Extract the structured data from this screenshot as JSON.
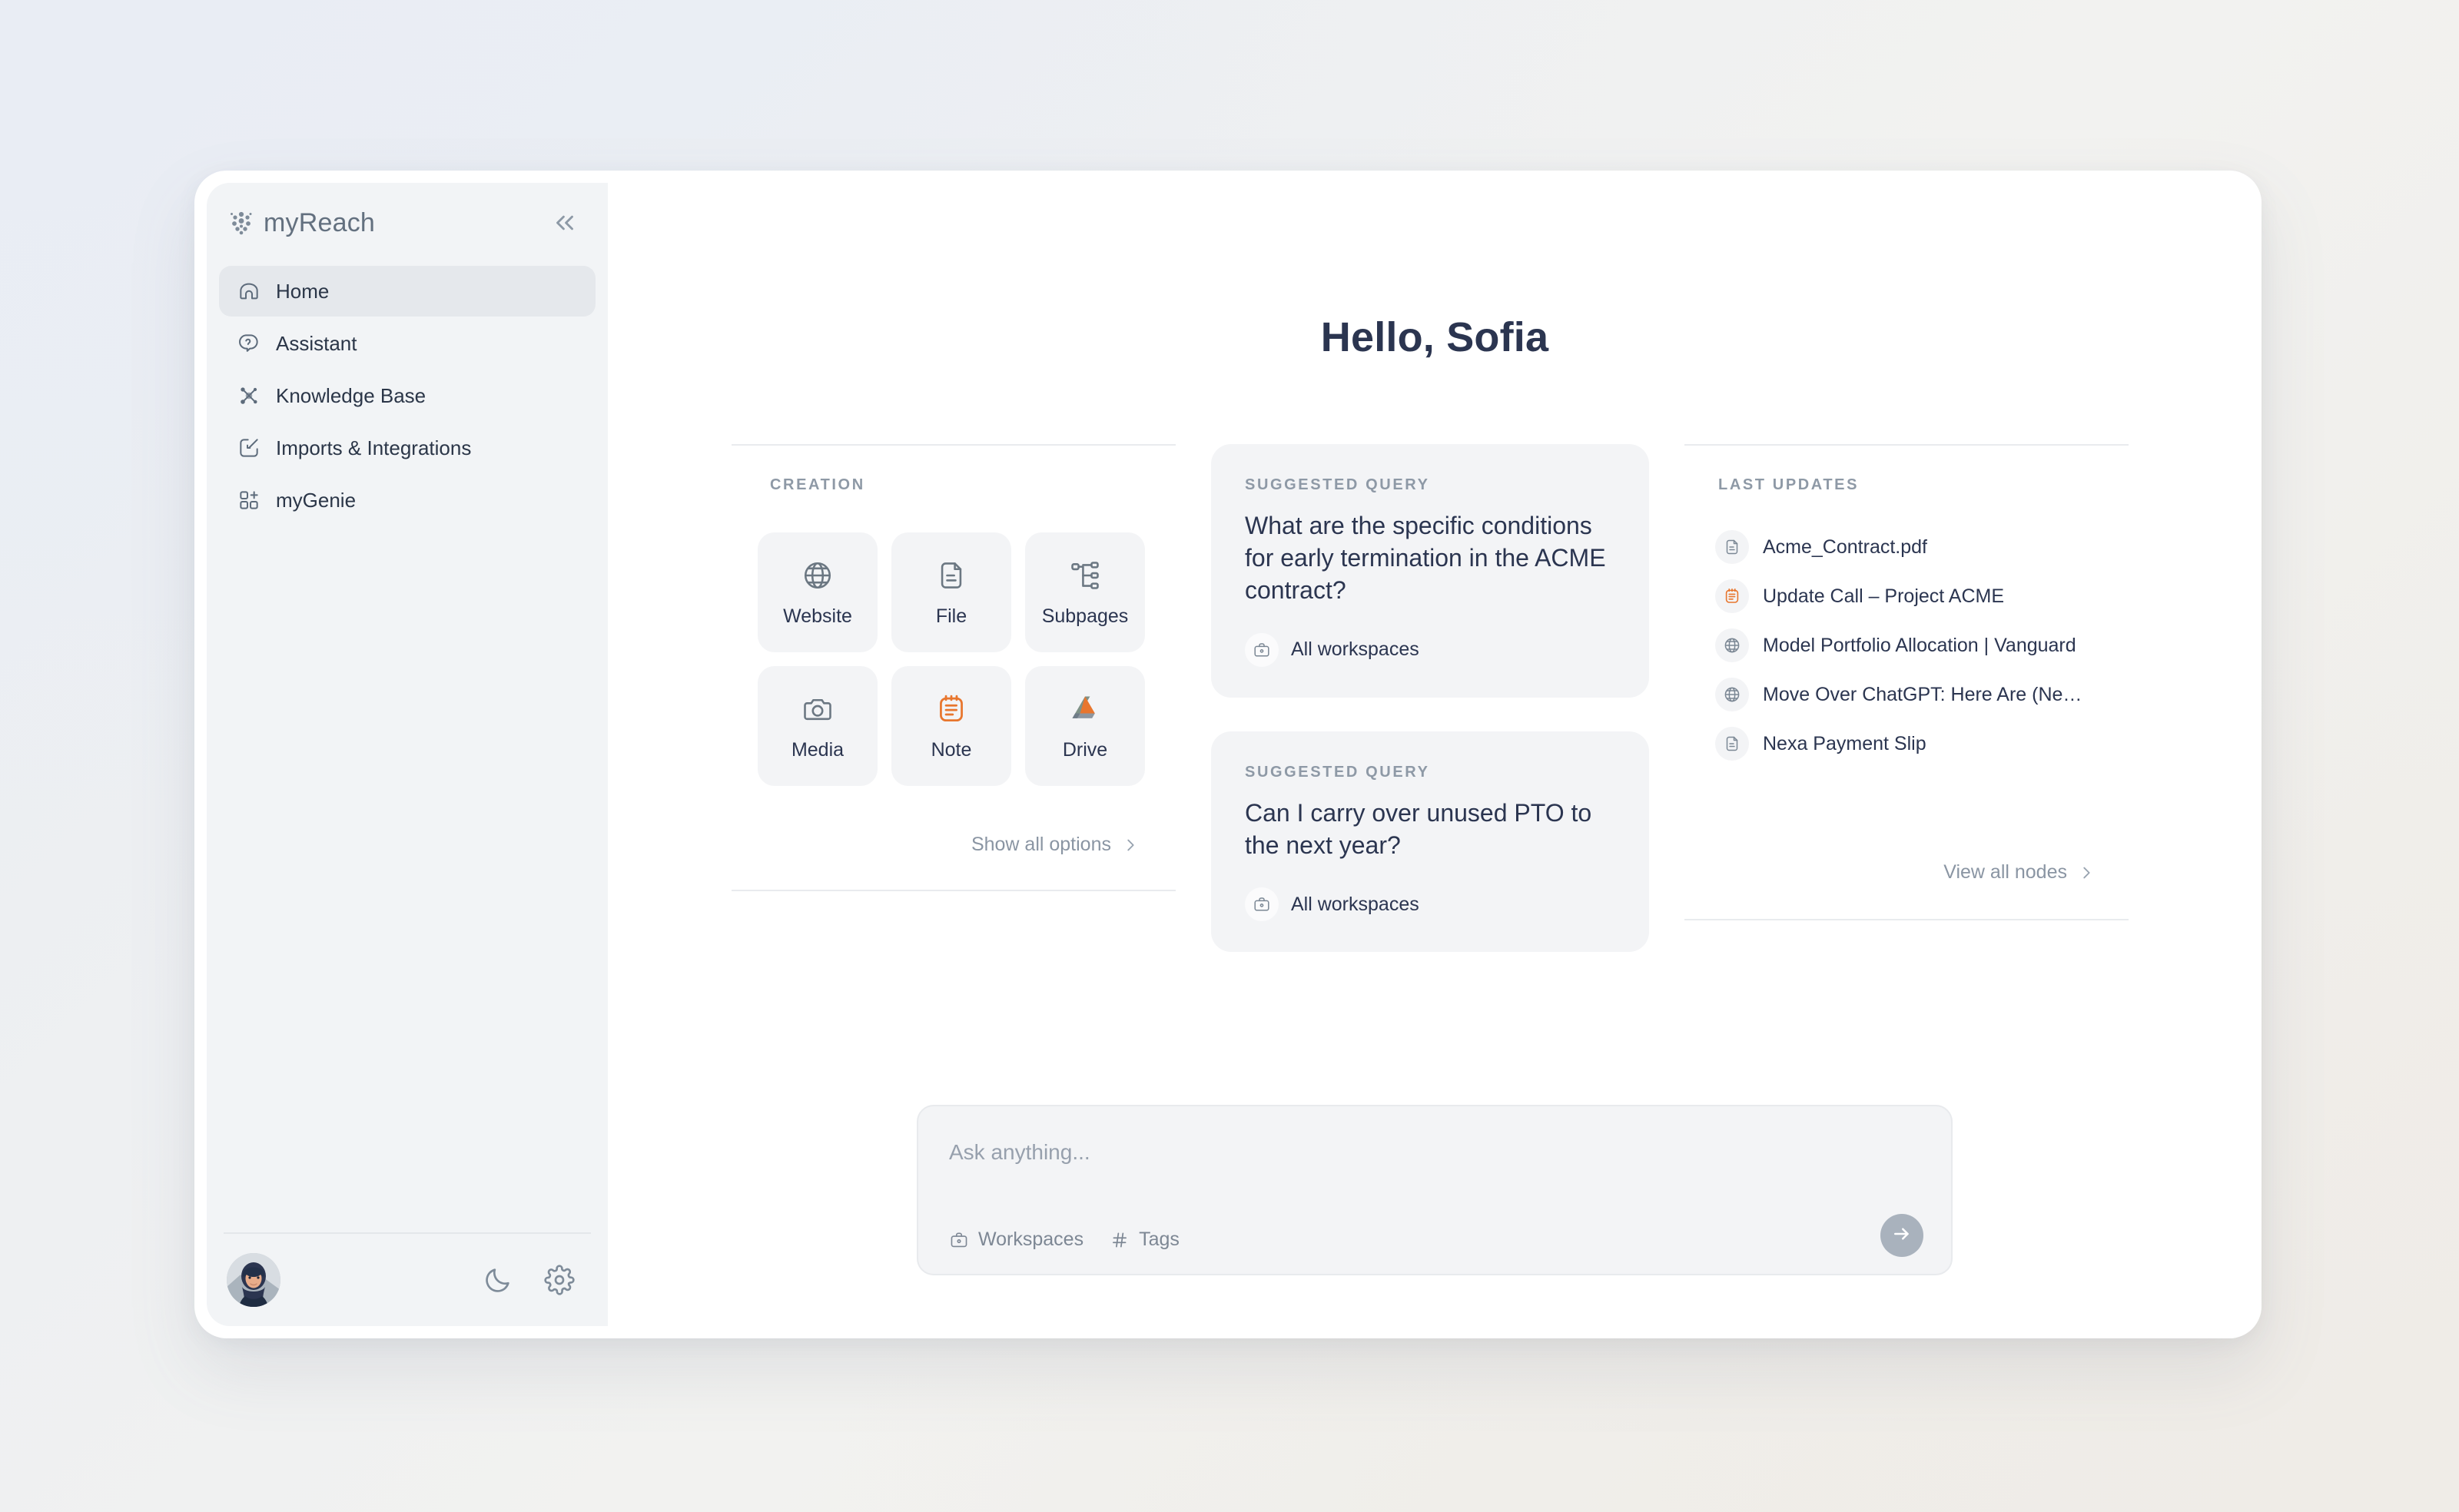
{
  "app": {
    "brand_name": "myReach",
    "collapse_icon": "chevrons-left-icon"
  },
  "sidebar": {
    "items": [
      {
        "label": "Home",
        "icon": "home-icon",
        "active": true
      },
      {
        "label": "Assistant",
        "icon": "chat-assistant-icon",
        "active": false
      },
      {
        "label": "Knowledge Base",
        "icon": "graph-nodes-icon",
        "active": false
      },
      {
        "label": "Imports & Integrations",
        "icon": "import-arrow-icon",
        "active": false
      },
      {
        "label": "myGenie",
        "icon": "add-blocks-icon",
        "active": false
      }
    ],
    "footer": {
      "avatar": "user-avatar",
      "theme_toggle_icon": "moon-icon",
      "settings_icon": "gear-icon"
    }
  },
  "main": {
    "greeting": "Hello, Sofia",
    "creation": {
      "label": "CREATION",
      "tiles": [
        {
          "label": "Website",
          "icon": "globe-icon"
        },
        {
          "label": "File",
          "icon": "document-icon"
        },
        {
          "label": "Subpages",
          "icon": "sitemap-icon"
        },
        {
          "label": "Media",
          "icon": "camera-icon"
        },
        {
          "label": "Note",
          "icon": "note-icon"
        },
        {
          "label": "Drive",
          "icon": "google-drive-icon"
        }
      ],
      "show_all_label": "Show all options",
      "chevron_icon": "chevron-right-icon"
    },
    "suggested_queries": [
      {
        "label": "SUGGESTED QUERY",
        "text": "What are the specific conditions for early termination in the ACME contract?",
        "workspace": "All workspaces",
        "workspace_icon": "briefcase-icon"
      },
      {
        "label": "SUGGESTED QUERY",
        "text": "Can I carry over unused PTO to the next year?",
        "workspace": "All workspaces",
        "workspace_icon": "briefcase-icon"
      }
    ],
    "last_updates": {
      "label": "LAST UPDATES",
      "items": [
        {
          "title": "Acme_Contract.pdf",
          "icon": "document-icon"
        },
        {
          "title": "Update Call – Project ACME",
          "icon": "note-icon"
        },
        {
          "title": "Model Portfolio Allocation | Vanguard",
          "icon": "globe-icon"
        },
        {
          "title": "Move Over ChatGPT: Here Are (Ne…",
          "icon": "globe-icon"
        },
        {
          "title": "Nexa Payment Slip",
          "icon": "document-icon"
        }
      ],
      "view_all_label": "View all nodes",
      "chevron_icon": "chevron-right-icon"
    },
    "composer": {
      "placeholder": "Ask anything...",
      "workspaces_label": "Workspaces",
      "workspaces_icon": "briefcase-icon",
      "tags_label": "Tags",
      "tags_icon": "hash-icon",
      "send_icon": "arrow-right-icon"
    }
  },
  "colors": {
    "accent_orange": "#e8762e",
    "text_primary": "#2b3550",
    "text_muted": "#8e99a6",
    "sidebar_bg": "#f2f4f6",
    "tile_bg": "#f3f4f6"
  }
}
